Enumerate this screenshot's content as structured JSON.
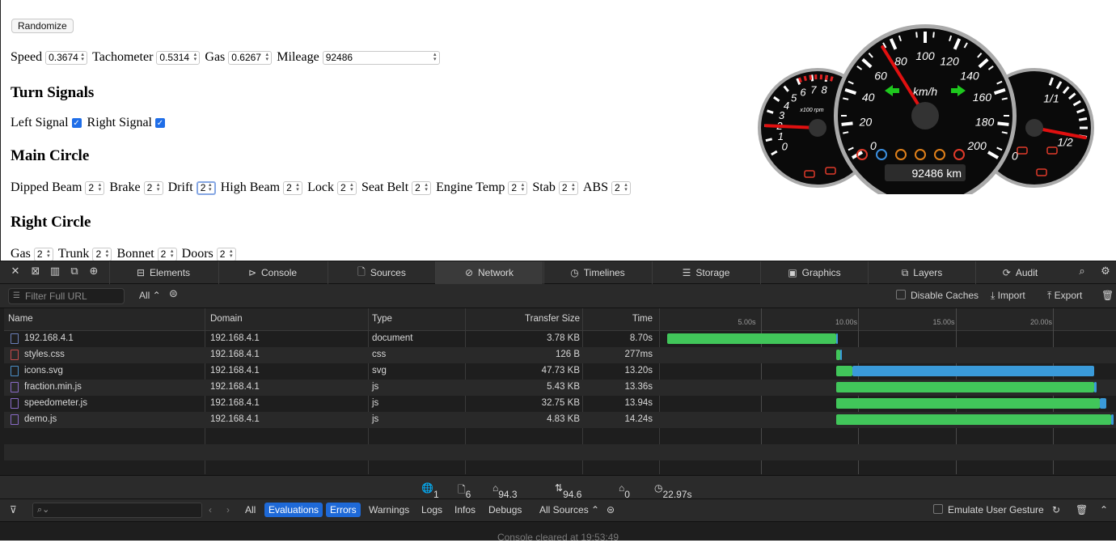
{
  "page": {
    "randomize_label": "Randomize",
    "controls": [
      {
        "label": "Speed",
        "value": "0.3674"
      },
      {
        "label": "Tachometer",
        "value": "0.5314"
      },
      {
        "label": "Gas",
        "value": "0.6267"
      },
      {
        "label": "Mileage",
        "value": "92486"
      }
    ],
    "turn_signals_title": "Turn Signals",
    "left_signal_label": "Left Signal",
    "right_signal_label": "Right Signal",
    "main_circle_title": "Main Circle",
    "main_circle_items": [
      {
        "label": "Dipped Beam",
        "value": "2"
      },
      {
        "label": "Brake",
        "value": "2"
      },
      {
        "label": "Drift",
        "value": "2"
      },
      {
        "label": "High Beam",
        "value": "2"
      },
      {
        "label": "Lock",
        "value": "2"
      },
      {
        "label": "Seat Belt",
        "value": "2"
      },
      {
        "label": "Engine Temp",
        "value": "2"
      },
      {
        "label": "Stab",
        "value": "2"
      },
      {
        "label": "ABS",
        "value": "2"
      }
    ],
    "right_circle_title": "Right Circle",
    "right_circle_items": [
      {
        "label": "Gas",
        "value": "2"
      },
      {
        "label": "Trunk",
        "value": "2"
      },
      {
        "label": "Bonnet",
        "value": "2"
      },
      {
        "label": "Doors",
        "value": "2"
      }
    ]
  },
  "dashboard": {
    "speed_unit": "km/h",
    "speed_ticks": [
      "0",
      "20",
      "40",
      "60",
      "80",
      "100",
      "120",
      "140",
      "160",
      "180",
      "200"
    ],
    "speed_value": 0.3674,
    "tach_unit": "x100 rpm",
    "tach_ticks": [
      "0",
      "1",
      "2",
      "3",
      "4",
      "5",
      "6",
      "7",
      "8"
    ],
    "tach_value": 0.5314,
    "gas_ticks": [
      "0",
      "1/2",
      "1/1"
    ],
    "gas_value": 0.6267,
    "odometer": "92486 km"
  },
  "devtools": {
    "tabs": [
      {
        "label": "Elements",
        "icon": "elements-icon"
      },
      {
        "label": "Console",
        "icon": "console-icon"
      },
      {
        "label": "Sources",
        "icon": "sources-icon"
      },
      {
        "label": "Network",
        "icon": "network-icon",
        "active": true
      },
      {
        "label": "Timelines",
        "icon": "timelines-icon"
      },
      {
        "label": "Storage",
        "icon": "storage-icon"
      },
      {
        "label": "Graphics",
        "icon": "graphics-icon"
      },
      {
        "label": "Layers",
        "icon": "layers-icon"
      },
      {
        "label": "Audit",
        "icon": "audit-icon"
      }
    ],
    "filter_placeholder": "Filter Full URL",
    "filter_type": "All",
    "disable_caches": "Disable Caches",
    "import": "Import",
    "export": "Export",
    "columns": [
      "Name",
      "Domain",
      "Type",
      "Transfer Size",
      "Time"
    ],
    "timeline_ticks": [
      "5.00s",
      "10.00s",
      "15.00s",
      "20.00s"
    ],
    "rows": [
      {
        "name": "192.168.4.1",
        "domain": "192.168.4.1",
        "type": "document",
        "size": "3.78 KB",
        "time": "8.70s",
        "icon_color": "#6b7fb8"
      },
      {
        "name": "styles.css",
        "domain": "192.168.4.1",
        "type": "css",
        "size": "126 B",
        "time": "277ms",
        "icon_color": "#c74b4b"
      },
      {
        "name": "icons.svg",
        "domain": "192.168.4.1",
        "type": "svg",
        "size": "47.73 KB",
        "time": "13.20s",
        "icon_color": "#4b8fc7"
      },
      {
        "name": "fraction.min.js",
        "domain": "192.168.4.1",
        "type": "js",
        "size": "5.43 KB",
        "time": "13.36s",
        "icon_color": "#8a6bc7"
      },
      {
        "name": "speedometer.js",
        "domain": "192.168.4.1",
        "type": "js",
        "size": "32.75 KB",
        "time": "13.94s",
        "icon_color": "#8a6bc7"
      },
      {
        "name": "demo.js",
        "domain": "192.168.4.1",
        "type": "js",
        "size": "4.83 KB",
        "time": "14.24s",
        "icon_color": "#8a6bc7"
      }
    ],
    "summary": {
      "domains": "1",
      "resources": "6",
      "size": "94.3 KB",
      "transferred": "94.6 KB",
      "redirects": "0",
      "time": "22.97s"
    },
    "console_filters": [
      "All",
      "Evaluations",
      "Errors",
      "Warnings",
      "Logs",
      "Infos",
      "Debugs"
    ],
    "console_sources": "All Sources",
    "emulate_gesture": "Emulate User Gesture",
    "console_message": "Console cleared at 19:53:49"
  }
}
